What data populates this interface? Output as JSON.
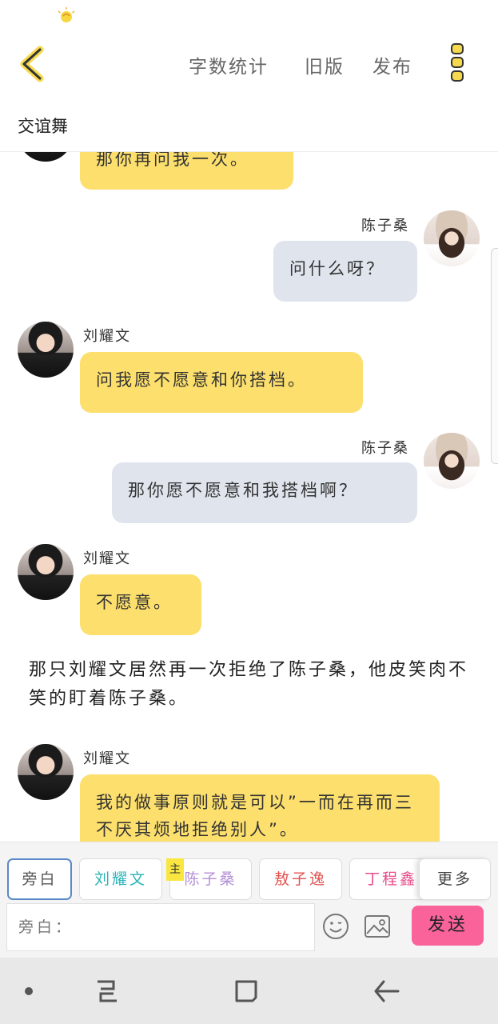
{
  "header": {
    "word_count": "字数统计",
    "old_version": "旧版",
    "publish": "发布",
    "title": "交谊舞"
  },
  "messages": [
    {
      "side": "left",
      "speaker": "",
      "text": "那你再问我一次。",
      "bubble": "yellow"
    },
    {
      "side": "right",
      "speaker": "陈子桑",
      "text": "问什么呀？",
      "bubble": "gray"
    },
    {
      "side": "left",
      "speaker": "刘耀文",
      "text": "问我愿不愿意和你搭档。",
      "bubble": "yellow"
    },
    {
      "side": "right",
      "speaker": "陈子桑",
      "text": "那你愿不愿意和我搭档啊？",
      "bubble": "gray"
    },
    {
      "side": "left",
      "speaker": "刘耀文",
      "text": "不愿意。",
      "bubble": "yellow"
    },
    {
      "narration": "那只刘耀文居然再一次拒绝了陈子桑，他皮笑肉不笑的盯着陈子桑。"
    },
    {
      "side": "left",
      "speaker": "刘耀文",
      "text": "我的做事原则就是可以”一而在再而三不厌其烦地拒绝别人”。",
      "bubble": "yellow"
    }
  ],
  "roles": [
    {
      "label": "旁白",
      "color": "#555555",
      "selected": true
    },
    {
      "label": "刘耀文",
      "color": "#2bb3b8"
    },
    {
      "label": "陈子桑",
      "color": "#b48fd6",
      "badge": "主"
    },
    {
      "label": "敖子逸",
      "color": "#e0524f"
    },
    {
      "label": "丁程鑫",
      "color": "#e84c8a"
    },
    {
      "label": "更多",
      "color": "#444444"
    }
  ],
  "input": {
    "placeholder": "旁白："
  },
  "send_label": "发送",
  "colors": {
    "bubble_yellow": "#fcdf6d",
    "bubble_gray": "#dfe4ed",
    "send": "#f9639a",
    "accent_yellow": "#f5d94e"
  },
  "icons": [
    "back-arrow-icon",
    "more-dots-icon",
    "emoji-icon",
    "image-icon",
    "nav-recents-icon",
    "nav-home-icon",
    "nav-back-icon"
  ]
}
